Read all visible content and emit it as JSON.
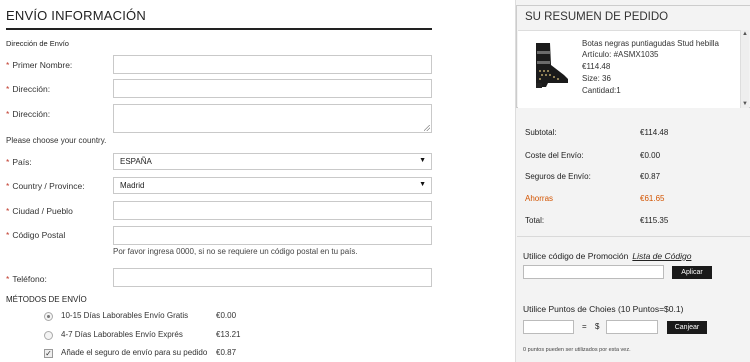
{
  "form": {
    "title": "ENVÍO INFORMACIÓN",
    "address_section": "Dirección de Envío",
    "fields": {
      "first_name": "Primer Nombre:",
      "address1": "Dirección:",
      "address2": "Dirección:",
      "country_prompt": "Please choose your country.",
      "country_label": "País:",
      "country_value": "ESPAÑA",
      "province_label": "Country / Province:",
      "province_value": "Madrid",
      "city": "Ciudad / Pueblo",
      "postal": "Código Postal",
      "postal_hint": "Por favor ingresa 0000, si no se requiere un código postal en tu país.",
      "phone": "Teléfono:"
    },
    "shipping_section": "MÉTODOS DE ENVÍO",
    "shipping": [
      {
        "name": "10-15 Días Laborables Envío Gratis",
        "price": "€0.00"
      },
      {
        "name": "4-7 Días Laborables Envío Exprés",
        "price": "€13.21"
      },
      {
        "name": "Añade el seguro de envío para su pedido",
        "price": "€0.87"
      }
    ],
    "required_mark": "*"
  },
  "summary": {
    "title": "SU RESUMEN DE PEDIDO",
    "product": {
      "name": "Botas negras puntiagudas Stud hebilla",
      "article": "Artículo: #ASMX1035",
      "price": "€114.48",
      "size": "Size: 36",
      "qty": "Cantidad:1"
    },
    "totals": {
      "subtotal_label": "Subtotal:",
      "subtotal": "€114.48",
      "shipping_label": "Coste del Envío:",
      "shipping": "€0.00",
      "insurance_label": "Seguros de Envío:",
      "insurance": "€0.87",
      "savings_label": "Ahorras",
      "savings": "€61.65",
      "total_label": "Total:",
      "total": "€115.35"
    },
    "promo": {
      "label": "Utilice código de Promoción",
      "link": "Lista de Código",
      "button": "Aplicar"
    },
    "points": {
      "label": "Utilice Puntos de Choies (10 Puntos=$0.1)",
      "equals": "=",
      "currency": "$",
      "button": "Canjear",
      "note": "0 puntos pueden ser utilizados por esta vez."
    },
    "accent_color": "#d35400"
  }
}
